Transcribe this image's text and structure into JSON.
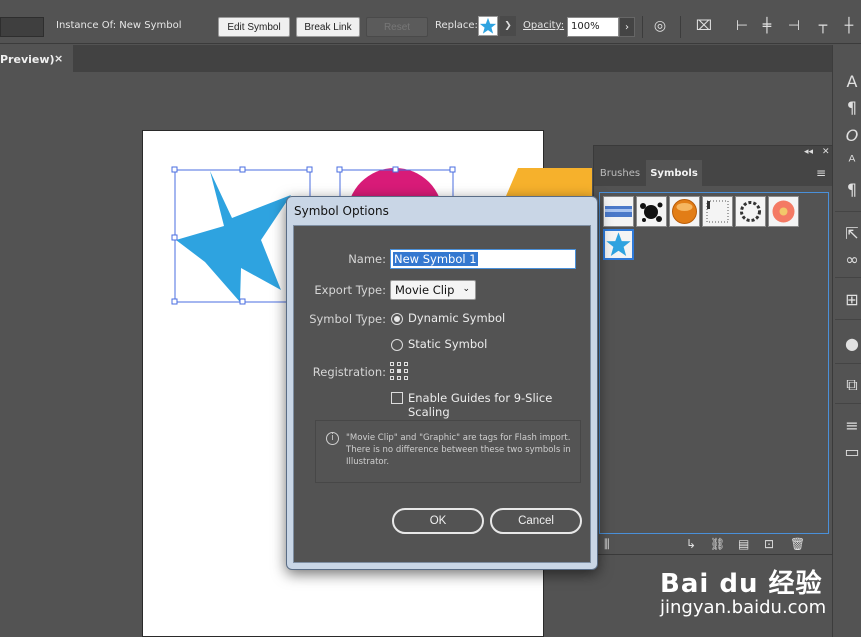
{
  "control_bar": {
    "instance_label": "Instance Of: New Symbol",
    "edit_symbol": "Edit Symbol",
    "break_link": "Break Link",
    "reset": "Reset",
    "replace_label": "Replace:",
    "opacity_label": "Opacity:",
    "opacity_value": "100%"
  },
  "document_tab": {
    "title": "Preview)",
    "close": "×"
  },
  "panel": {
    "tabs": [
      "Brushes",
      "Symbols"
    ],
    "active_tab": "Symbols",
    "symbols": [
      "blue-banner",
      "ink-splat",
      "orange-button",
      "dotted-frame",
      "ring-knot",
      "flower",
      "blue-star"
    ],
    "selected_symbol": "blue-star"
  },
  "dialog": {
    "title": "Symbol Options",
    "name_label": "Name:",
    "name_value": "New Symbol 1",
    "export_type_label": "Export Type:",
    "export_type_value": "Movie Clip",
    "symbol_type_label": "Symbol Type:",
    "dynamic_symbol": "Dynamic Symbol",
    "static_symbol": "Static Symbol",
    "symbol_type_selected": "Dynamic Symbol",
    "registration_label": "Registration:",
    "enable_guides": "Enable Guides for 9-Slice Scaling",
    "enable_guides_checked": false,
    "info_text": "\"Movie Clip\" and \"Graphic\" are tags for Flash import. There is no difference between these two symbols in Illustrator.",
    "ok": "OK",
    "cancel": "Cancel"
  },
  "watermark": {
    "logo": "Bai du 经验",
    "url": "jingyan.baidu.com"
  },
  "colors": {
    "star_blue": "#2ea3e0",
    "magenta": "#d81b78",
    "orange": "#f6b12c",
    "selection_blue": "#4a6ee0",
    "ui_gray": "#535353"
  }
}
